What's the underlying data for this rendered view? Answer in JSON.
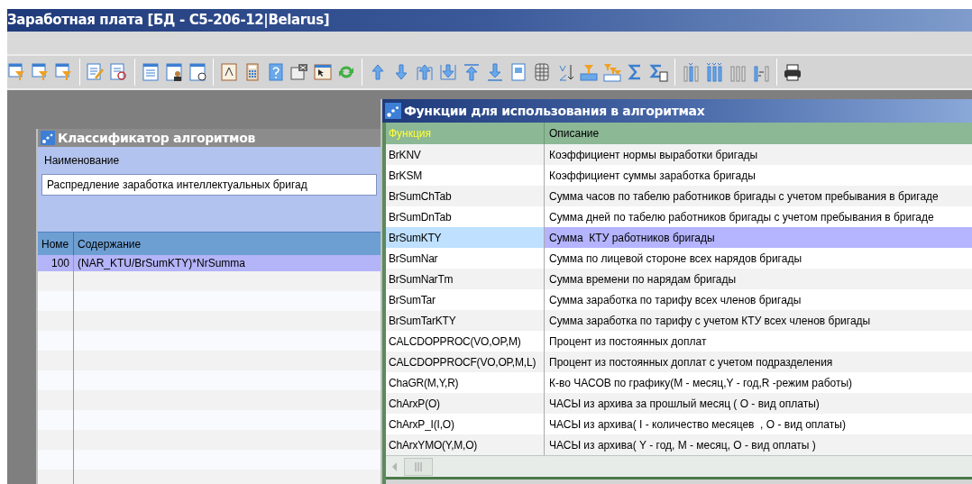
{
  "window": {
    "title": "Заработная плата [БД - C5-206-12|Belarus]"
  },
  "left_window": {
    "title": "Классификатор алгоритмов",
    "name_label": "Наименование",
    "name_value": "Распредление заработка интеллектуальных бригад",
    "table": {
      "columns": [
        "Номе",
        "Содержание"
      ],
      "rows": [
        {
          "number": "100",
          "content": "(NAR_KTU/BrSumKTY)*NrSumma",
          "selected": true
        }
      ]
    }
  },
  "right_window": {
    "title": "Функции для использования в алгоритмах",
    "table": {
      "columns": [
        "Функция",
        "Описание"
      ],
      "rows": [
        {
          "function": "BrKNV",
          "description": "Коэффициент нормы выработки бригады",
          "selected": false
        },
        {
          "function": "BrKSM",
          "description": "Коэффициент суммы заработка бригады",
          "selected": false
        },
        {
          "function": "BrSumChTab",
          "description": "Сумма часов по табелю работников бригады с учетом пребывания в бригаде",
          "selected": false
        },
        {
          "function": "BrSumDnTab",
          "description": "Сумма дней по табелю работников бригады с учетом пребывания в бригаде",
          "selected": false
        },
        {
          "function": "BrSumKTY",
          "description": "Сумма  КТУ работников бригады",
          "selected": true
        },
        {
          "function": "BrSumNar",
          "description": "Сумма по лицевой стороне всех нарядов бригады",
          "selected": false
        },
        {
          "function": "BrSumNarTm",
          "description": "Сумма времени по нарядам бригады",
          "selected": false
        },
        {
          "function": "BrSumTar",
          "description": "Сумма заработка по тарифу всех членов бригады",
          "selected": false
        },
        {
          "function": "BrSumTarKTY",
          "description": "Сумма заработка по тарифу с учетом КТУ всех членов бригады",
          "selected": false
        },
        {
          "function": "CALCDOPPROC(VO,OP,M)",
          "description": "Процент из постоянных доплат",
          "selected": false
        },
        {
          "function": "CALCDOPPROCF(VO,OP,M,L)",
          "description": "Процент из постоянных доплат с учетом подразделения",
          "selected": false
        },
        {
          "function": "ChaGR(M,Y,R)",
          "description": "К-во ЧАСОВ по графику(M - месяц,Y - год,R -режим работы)",
          "selected": false
        },
        {
          "function": "ChArxP(O)",
          "description": "ЧАСЫ из архива за прошлый месяц ( O - вид оплаты)",
          "selected": false
        },
        {
          "function": "ChArxP_I(I,O)",
          "description": "ЧАСЫ из архива( I - количество месяцев  , O - вид оплаты)",
          "selected": false
        },
        {
          "function": "ChArxYMO(Y,M,O)",
          "description": "ЧАСЫ из архива( Y - год, M - месяц, O - вид оплаты )",
          "selected": false
        }
      ]
    }
  }
}
